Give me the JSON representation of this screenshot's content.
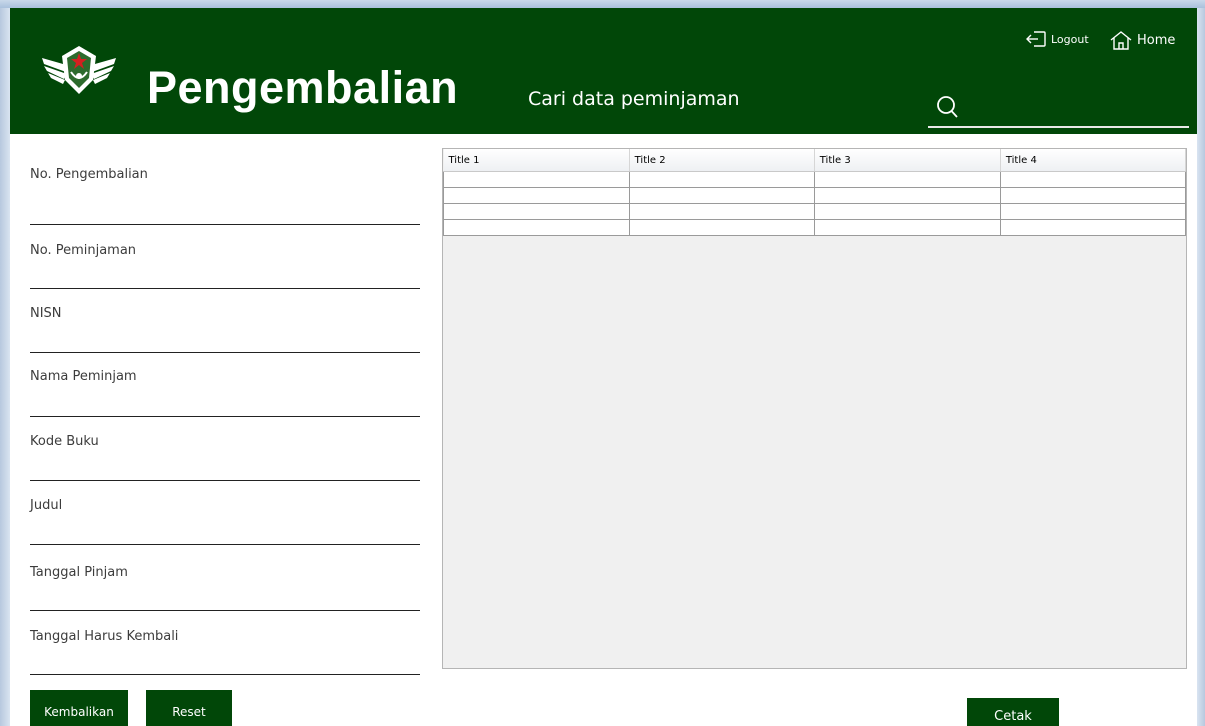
{
  "header": {
    "title": "Pengembalian",
    "search_hint": "Cari data peminjaman",
    "search_value": "",
    "logout_label": "Logout",
    "home_label": "Home"
  },
  "form": {
    "fields": [
      {
        "label": "No. Pengembalian",
        "value": ""
      },
      {
        "label": "No. Peminjaman",
        "value": ""
      },
      {
        "label": "NISN",
        "value": ""
      },
      {
        "label": "Nama Peminjam",
        "value": ""
      },
      {
        "label": "Kode Buku",
        "value": ""
      },
      {
        "label": "Judul",
        "value": ""
      },
      {
        "label": "Tanggal Pinjam",
        "value": ""
      },
      {
        "label": "Tanggal Harus Kembali",
        "value": ""
      }
    ]
  },
  "table": {
    "columns": [
      "Title 1",
      "Title 2",
      "Title 3",
      "Title 4"
    ],
    "rows": [
      [
        "",
        "",
        "",
        ""
      ],
      [
        "",
        "",
        "",
        ""
      ],
      [
        "",
        "",
        "",
        ""
      ],
      [
        "",
        "",
        "",
        ""
      ]
    ]
  },
  "buttons": {
    "kembalikan": "Kembalikan",
    "reset": "Reset",
    "cetak": "Cetak"
  },
  "colors": {
    "header_bg": "#014708",
    "button_bg": "#014708"
  }
}
